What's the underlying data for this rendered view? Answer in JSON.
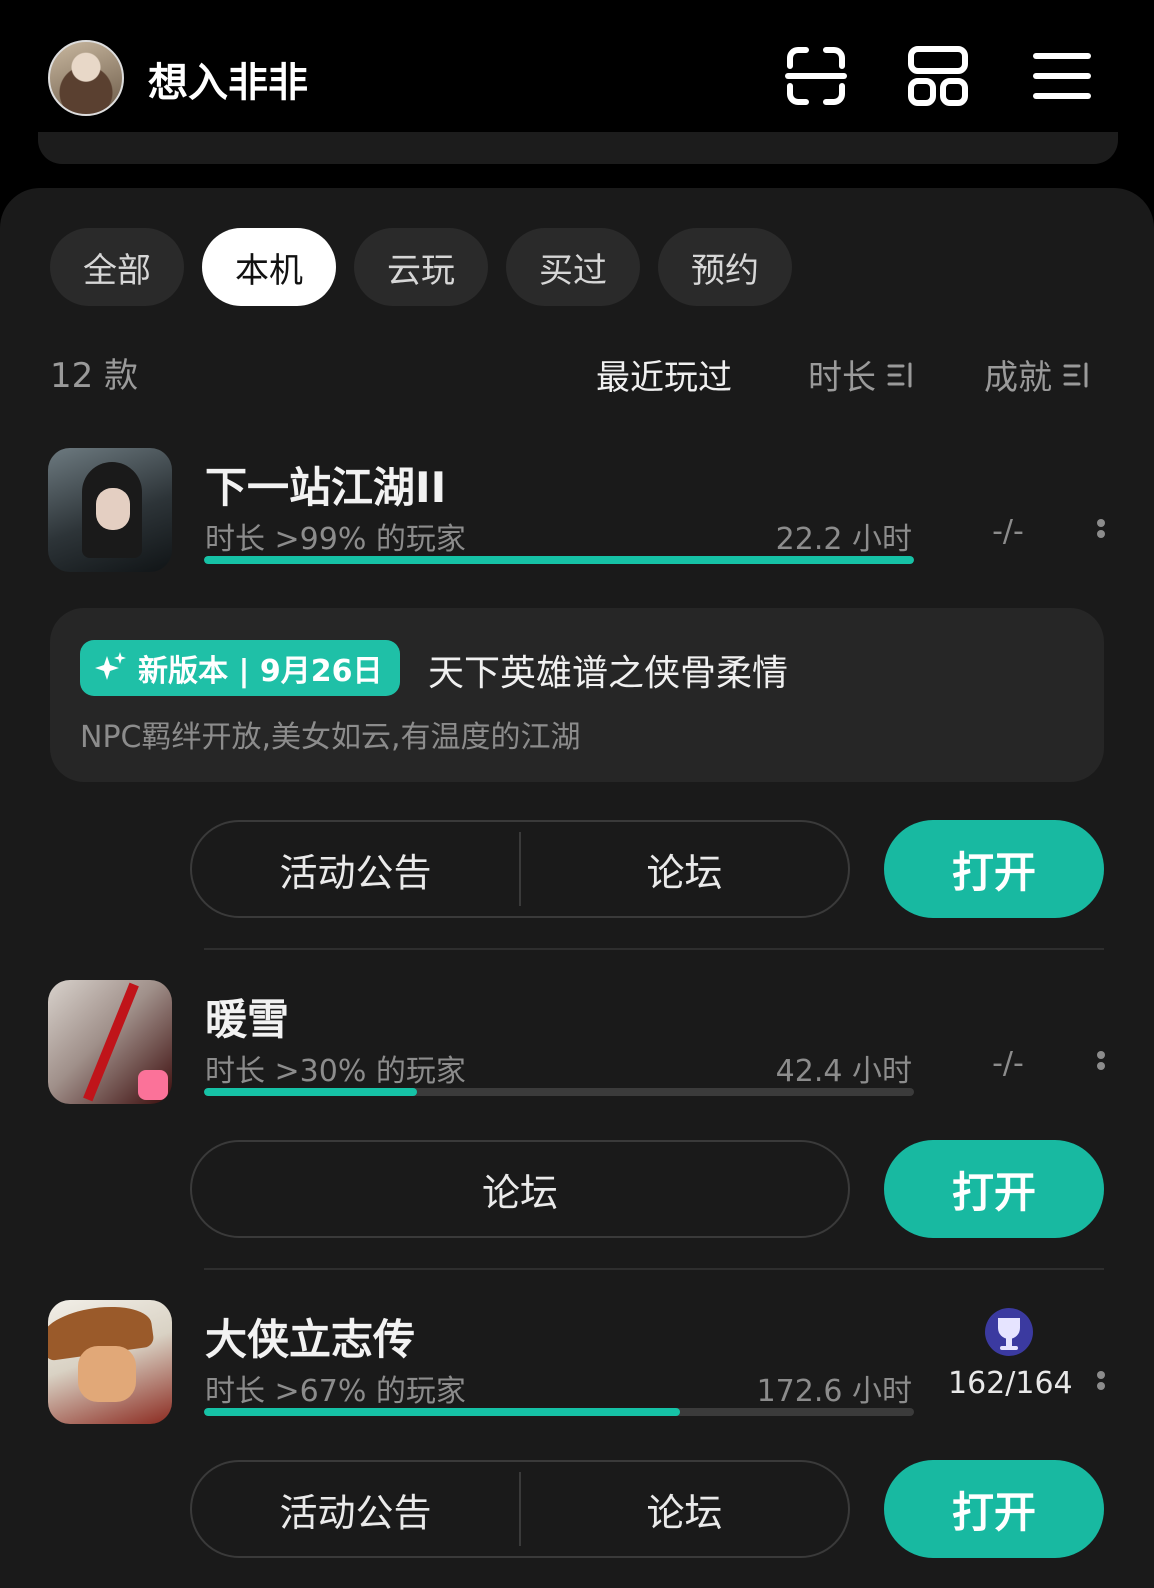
{
  "header": {
    "username": "想入非非"
  },
  "filters": [
    "全部",
    "本机",
    "云玩",
    "买过",
    "预约"
  ],
  "active_filter_index": 1,
  "count_label": "12 款",
  "sort": {
    "recent": "最近玩过",
    "duration": "时长",
    "achievement": "成就"
  },
  "games": [
    {
      "title": "下一站江湖II",
      "rank": "时长 >99% 的玩家",
      "hours": "22.2 小时",
      "achievement": "-/-",
      "progress": 1.0,
      "notice": {
        "badge": "新版本 | 9月26日",
        "title": "天下英雄谱之侠骨柔情",
        "desc": "NPC羁绊开放,美女如云,有温度的江湖"
      },
      "buttons": [
        "活动公告",
        "论坛"
      ],
      "open": "打开"
    },
    {
      "title": "暖雪",
      "rank": "时长 >30% 的玩家",
      "hours": "42.4 小时",
      "achievement": "-/-",
      "progress": 0.3,
      "buttons": [
        "论坛"
      ],
      "open": "打开"
    },
    {
      "title": "大侠立志传",
      "rank": "时长 >67% 的玩家",
      "hours": "172.6 小时",
      "achievement": "162/164",
      "progress": 0.67,
      "buttons": [
        "活动公告",
        "论坛"
      ],
      "open": "打开"
    }
  ],
  "colors": {
    "accent": "#18b9a1",
    "background": "#1a1a1a"
  }
}
